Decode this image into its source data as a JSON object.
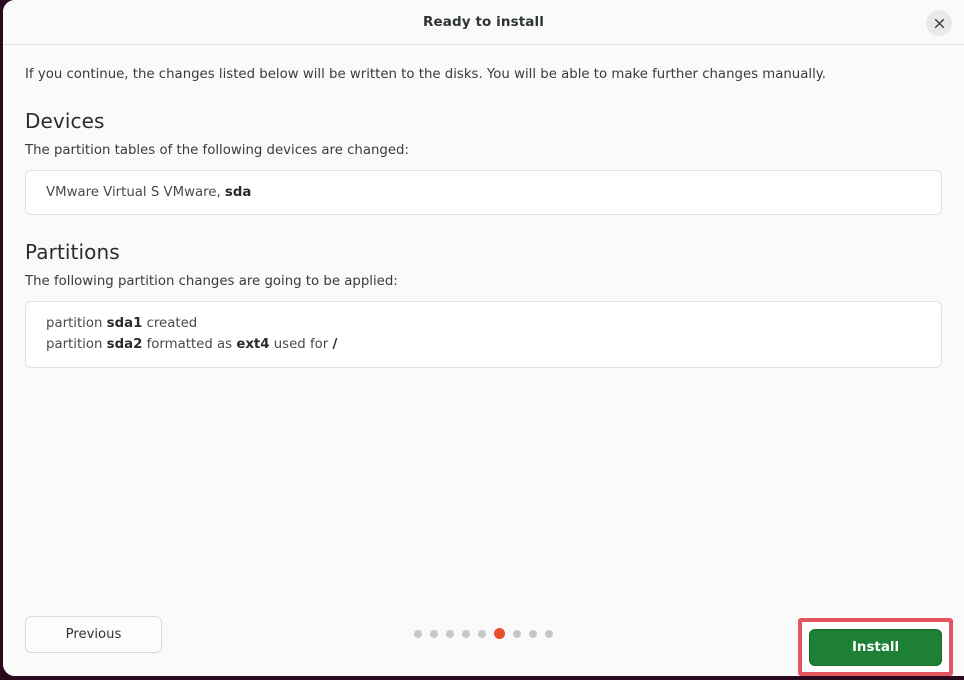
{
  "window": {
    "title": "Ready to install",
    "close_icon": "close-icon"
  },
  "content": {
    "intro": "If you continue, the changes listed below will be written to the disks. You will be able to make further changes manually.",
    "devices": {
      "heading": "Devices",
      "subtitle": "The partition tables of the following devices are changed:",
      "entries": [
        {
          "prefix": "VMware Virtual S VMware, ",
          "strong": "sda",
          "suffix": ""
        }
      ]
    },
    "partitions": {
      "heading": "Partitions",
      "subtitle": "The following partition changes are going to be applied:",
      "entries": [
        {
          "text_1": "partition ",
          "strong_1": "sda1",
          "text_2": " created",
          "strong_2": "",
          "text_3": "",
          "strong_3": "",
          "text_4": ""
        },
        {
          "text_1": "partition ",
          "strong_1": "sda2",
          "text_2": " formatted as ",
          "strong_2": "ext4",
          "text_3": " used for ",
          "strong_3": "/",
          "text_4": ""
        }
      ]
    }
  },
  "footer": {
    "previous_label": "Previous",
    "install_label": "Install",
    "pagination": {
      "total": 9,
      "active_index": 6,
      "active_color": "#e8502a",
      "inactive_color": "#c9c7c5"
    },
    "install_accent_color": "#1d8034",
    "highlight_color": "#e4545f"
  }
}
